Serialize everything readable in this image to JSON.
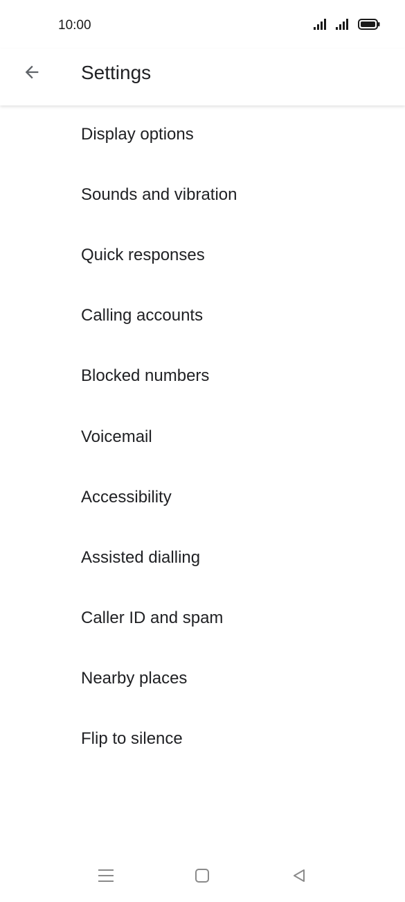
{
  "status_bar": {
    "time": "10:00",
    "icons": [
      "signal-icon",
      "signal-icon",
      "battery-icon"
    ]
  },
  "app_bar": {
    "back_icon": "arrow-left-icon",
    "title": "Settings"
  },
  "settings": {
    "items": [
      {
        "label": "Display options"
      },
      {
        "label": "Sounds and vibration"
      },
      {
        "label": "Quick responses"
      },
      {
        "label": "Calling accounts"
      },
      {
        "label": "Blocked numbers"
      },
      {
        "label": "Voicemail"
      },
      {
        "label": "Accessibility"
      },
      {
        "label": "Assisted dialling"
      },
      {
        "label": "Caller ID and spam"
      },
      {
        "label": "Nearby places"
      },
      {
        "label": "Flip to silence"
      }
    ]
  },
  "nav_bar": {
    "icons": [
      "menu-icon",
      "home-icon",
      "back-triangle-icon"
    ]
  },
  "colors": {
    "text": "#202124",
    "icon": "#5f6368",
    "nav_icon": "#8a8a8a",
    "background": "#ffffff"
  }
}
